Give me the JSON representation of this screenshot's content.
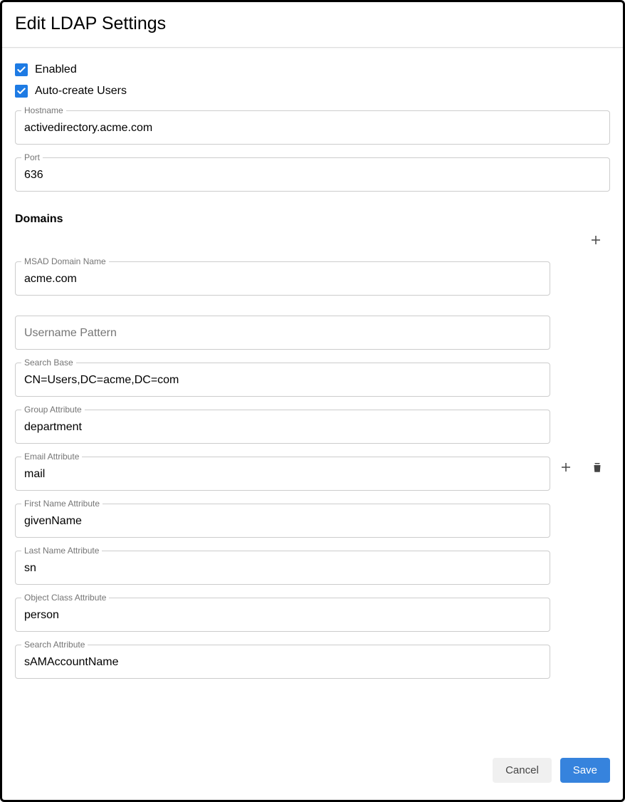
{
  "header": {
    "title": "Edit LDAP Settings"
  },
  "checkboxes": {
    "enabled": {
      "label": "Enabled",
      "checked": true
    },
    "autocreate": {
      "label": "Auto-create Users",
      "checked": true
    }
  },
  "fields": {
    "hostname": {
      "label": "Hostname",
      "value": "activedirectory.acme.com"
    },
    "port": {
      "label": "Port",
      "value": "636"
    }
  },
  "domains": {
    "heading": "Domains",
    "item": {
      "msad_domain": {
        "label": "MSAD Domain Name",
        "value": "acme.com"
      },
      "username_pattern": {
        "placeholder": "Username Pattern",
        "value": ""
      },
      "search_base": {
        "label": "Search Base",
        "value": "CN=Users,DC=acme,DC=com"
      },
      "group_attr": {
        "label": "Group Attribute",
        "value": "department"
      },
      "email_attr": {
        "label": "Email Attribute",
        "value": "mail"
      },
      "first_name_attr": {
        "label": "First Name Attribute",
        "value": "givenName"
      },
      "last_name_attr": {
        "label": "Last Name Attribute",
        "value": "sn"
      },
      "object_class_attr": {
        "label": "Object Class Attribute",
        "value": "person"
      },
      "search_attr": {
        "label": "Search Attribute",
        "value": "sAMAccountName"
      }
    }
  },
  "footer": {
    "cancel": "Cancel",
    "save": "Save"
  }
}
